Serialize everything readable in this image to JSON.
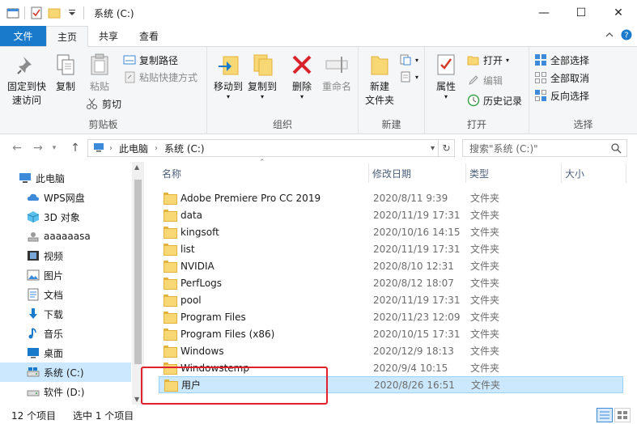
{
  "window": {
    "title": "系统 (C:)",
    "minimize_icon": "—",
    "maximize_icon": "☐",
    "close_icon": "✕"
  },
  "tabs": {
    "file": "文件",
    "home": "主页",
    "share": "共享",
    "view": "查看"
  },
  "ribbon": {
    "clipboard": {
      "label": "剪贴板",
      "pin_l1": "固定到快",
      "pin_l2": "速访问",
      "copy": "复制",
      "paste": "粘贴",
      "copy_path": "复制路径",
      "paste_shortcut": "粘贴快捷方式",
      "cut": "剪切"
    },
    "organize": {
      "label": "组织",
      "move_to": "移动到",
      "copy_to": "复制到",
      "delete": "删除",
      "rename": "重命名"
    },
    "new": {
      "label": "新建",
      "new_folder_l1": "新建",
      "new_folder_l2": "文件夹"
    },
    "open": {
      "label": "打开",
      "properties": "属性",
      "open": "打开",
      "edit": "编辑",
      "history": "历史记录"
    },
    "select": {
      "label": "选择",
      "select_all": "全部选择",
      "select_none": "全部取消",
      "invert": "反向选择"
    }
  },
  "address": {
    "crumb_1": "此电脑",
    "crumb_2": "系统 (C:)",
    "search_placeholder": "搜索\"系统 (C:)\""
  },
  "navpane": {
    "items": [
      {
        "label": "此电脑",
        "icon": "computer-icon"
      },
      {
        "label": "WPS网盘",
        "icon": "cloud-icon"
      },
      {
        "label": "3D 对象",
        "icon": "cube-icon"
      },
      {
        "label": "aaaaaasa",
        "icon": "user-drive-icon"
      },
      {
        "label": "视频",
        "icon": "video-icon"
      },
      {
        "label": "图片",
        "icon": "pictures-icon"
      },
      {
        "label": "文档",
        "icon": "documents-icon"
      },
      {
        "label": "下载",
        "icon": "download-icon"
      },
      {
        "label": "音乐",
        "icon": "music-icon"
      },
      {
        "label": "桌面",
        "icon": "desktop-icon"
      },
      {
        "label": "系统 (C:)",
        "icon": "drive-icon"
      },
      {
        "label": "软件 (D:)",
        "icon": "drive-icon"
      }
    ]
  },
  "filelist": {
    "columns": {
      "name": "名称",
      "date": "修改日期",
      "type": "类型",
      "size": "大小"
    },
    "rows": [
      {
        "name": "Adobe Premiere Pro CC 2019",
        "date": "2020/8/11 9:39",
        "type": "文件夹"
      },
      {
        "name": "data",
        "date": "2020/11/19 17:31",
        "type": "文件夹"
      },
      {
        "name": "kingsoft",
        "date": "2020/10/16 14:15",
        "type": "文件夹"
      },
      {
        "name": "list",
        "date": "2020/11/19 17:31",
        "type": "文件夹"
      },
      {
        "name": "NVIDIA",
        "date": "2020/8/10 12:31",
        "type": "文件夹"
      },
      {
        "name": "PerfLogs",
        "date": "2020/8/12 18:07",
        "type": "文件夹"
      },
      {
        "name": "pool",
        "date": "2020/11/19 17:31",
        "type": "文件夹"
      },
      {
        "name": "Program Files",
        "date": "2020/11/23 12:09",
        "type": "文件夹"
      },
      {
        "name": "Program Files (x86)",
        "date": "2020/10/15 17:31",
        "type": "文件夹"
      },
      {
        "name": "Windows",
        "date": "2020/12/9 18:13",
        "type": "文件夹"
      },
      {
        "name": "Windowstemp",
        "date": "2020/9/4 10:15",
        "type": "文件夹"
      },
      {
        "name": "用户",
        "date": "2020/8/26 16:51",
        "type": "文件夹"
      }
    ]
  },
  "status": {
    "count": "12 个项目",
    "selected": "选中 1 个项目"
  },
  "colors": {
    "accent": "#1979ca",
    "selection": "#cce8ff",
    "highlight_box": "#e0202a"
  }
}
